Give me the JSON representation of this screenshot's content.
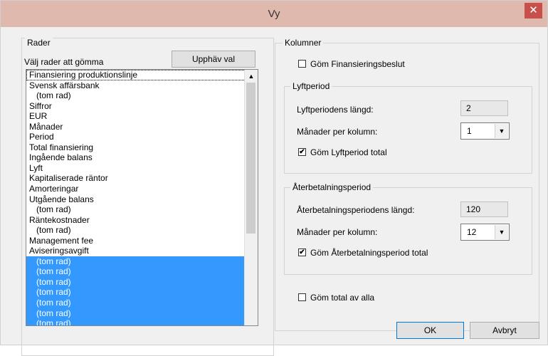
{
  "window": {
    "title": "Vy",
    "close_glyph": "✕"
  },
  "rows_group": {
    "legend": "Rader",
    "instruction": "Välj rader att gömma",
    "clear_button": "Upphäv val",
    "items": [
      {
        "label": "Finansiering produktionslinje",
        "indent": false,
        "selected": false,
        "focused": true
      },
      {
        "label": "Svensk affärsbank",
        "indent": false,
        "selected": false
      },
      {
        "label": "(tom rad)",
        "indent": true,
        "selected": false
      },
      {
        "label": "Siffror",
        "indent": false,
        "selected": false
      },
      {
        "label": "EUR",
        "indent": false,
        "selected": false
      },
      {
        "label": "Månader",
        "indent": false,
        "selected": false
      },
      {
        "label": "Period",
        "indent": false,
        "selected": false
      },
      {
        "label": "Total finansiering",
        "indent": false,
        "selected": false
      },
      {
        "label": "Ingående balans",
        "indent": false,
        "selected": false
      },
      {
        "label": "Lyft",
        "indent": false,
        "selected": false
      },
      {
        "label": "Kapitaliserade räntor",
        "indent": false,
        "selected": false
      },
      {
        "label": "Amorteringar",
        "indent": false,
        "selected": false
      },
      {
        "label": "Utgående balans",
        "indent": false,
        "selected": false
      },
      {
        "label": "(tom rad)",
        "indent": true,
        "selected": false
      },
      {
        "label": "Räntekostnader",
        "indent": false,
        "selected": false
      },
      {
        "label": "(tom rad)",
        "indent": true,
        "selected": false
      },
      {
        "label": "Management fee",
        "indent": false,
        "selected": false
      },
      {
        "label": "Aviseringsavgift",
        "indent": false,
        "selected": false
      },
      {
        "label": "(tom rad)",
        "indent": true,
        "selected": true
      },
      {
        "label": "(tom rad)",
        "indent": true,
        "selected": true
      },
      {
        "label": "(tom rad)",
        "indent": true,
        "selected": true
      },
      {
        "label": "(tom rad)",
        "indent": true,
        "selected": true
      },
      {
        "label": "(tom rad)",
        "indent": true,
        "selected": true
      },
      {
        "label": "(tom rad)",
        "indent": true,
        "selected": true
      },
      {
        "label": "(tom rad)",
        "indent": true,
        "selected": true
      }
    ],
    "scroll_up_glyph": "▲",
    "scroll_down_glyph": "▼"
  },
  "columns_group": {
    "legend": "Kolumner",
    "hide_financing": {
      "label": "Göm Finansieringsbeslut",
      "checked": false
    },
    "lift_period": {
      "legend": "Lyftperiod",
      "length_label": "Lyftperiodens längd:",
      "length_value": "2",
      "months_label": "Månader per kolumn:",
      "months_value": "1",
      "hide_total": {
        "label": "Göm Lyftperiod total",
        "checked": true
      }
    },
    "repayment_period": {
      "legend": "Återbetalningsperiod",
      "length_label": "Återbetalningsperiodens längd:",
      "length_value": "120",
      "months_label": "Månader per kolumn:",
      "months_value": "12",
      "hide_total": {
        "label": "Göm Återbetalningsperiod total",
        "checked": true
      }
    },
    "hide_all_total": {
      "label": "Göm total av alla",
      "checked": false
    }
  },
  "buttons": {
    "ok": "OK",
    "cancel": "Avbryt"
  },
  "check_glyph": "✔",
  "dropdown_glyph": "▼",
  "colors": {
    "titlebar": "#e0b9ae",
    "close": "#c7504b",
    "selection": "#3399ff"
  }
}
